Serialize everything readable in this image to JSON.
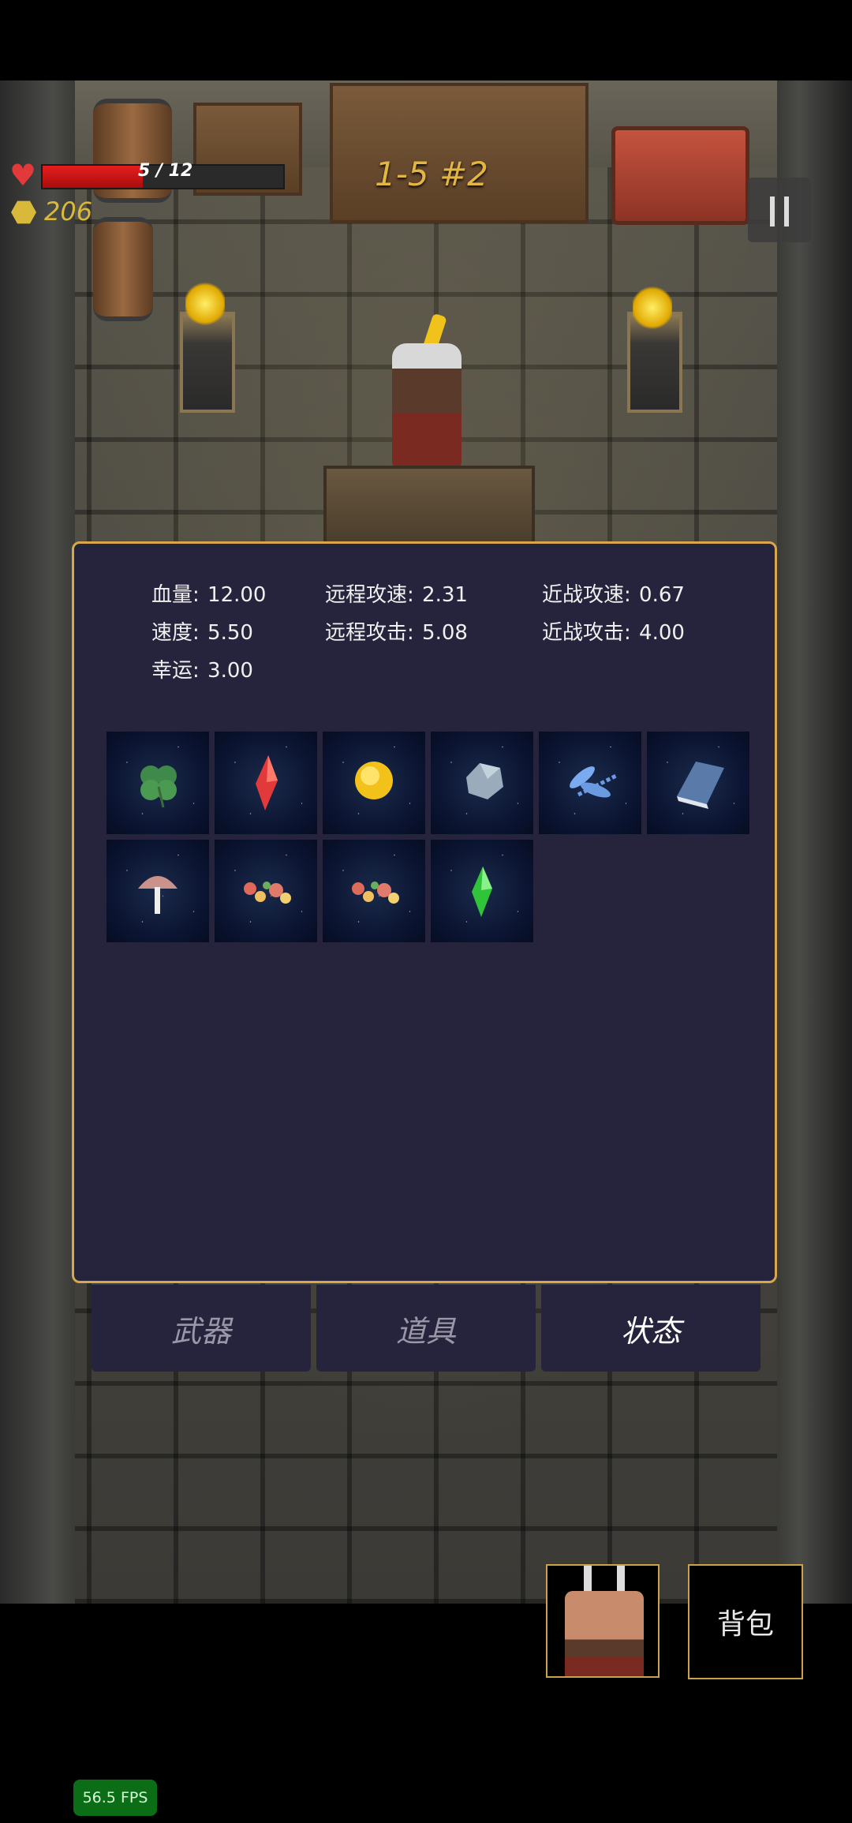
{
  "hud": {
    "hp_current": 5,
    "hp_max": 12,
    "hp_text": "5 / 12",
    "coins": "206",
    "level": "1-5 #2",
    "heart_icon": "heart-icon",
    "coin_icon": "coin-icon"
  },
  "stats": {
    "rows": [
      {
        "label": "血量:",
        "value": "12.00"
      },
      {
        "label": "远程攻速:",
        "value": "2.31"
      },
      {
        "label": "近战攻速:",
        "value": "0.67"
      },
      {
        "label": "速度:",
        "value": "5.50"
      },
      {
        "label": "远程攻击:",
        "value": "5.08"
      },
      {
        "label": "近战攻击:",
        "value": "4.00"
      },
      {
        "label": "幸运:",
        "value": "3.00"
      }
    ]
  },
  "items": [
    {
      "icon": "four-leaf-clover-icon"
    },
    {
      "icon": "red-crystal-icon"
    },
    {
      "icon": "sun-orb-icon"
    },
    {
      "icon": "gray-stone-icon"
    },
    {
      "icon": "dragonfly-icon"
    },
    {
      "icon": "blue-book-icon"
    },
    {
      "icon": "mushroom-icon"
    },
    {
      "icon": "flower-cluster-icon"
    },
    {
      "icon": "flower-cluster-icon"
    },
    {
      "icon": "green-crystal-icon"
    }
  ],
  "tabs": [
    {
      "label": "武器",
      "active": false
    },
    {
      "label": "道具",
      "active": false
    },
    {
      "label": "状态",
      "active": true
    }
  ],
  "bottom": {
    "bag_label": "背包"
  },
  "fps": "56.5 FPS",
  "colors": {
    "panel_bg": "#26233c",
    "panel_border": "#d7a74a",
    "hp_red": "#e61e1e",
    "gold": "#d8b93a",
    "fps_green": "#0b6e17"
  }
}
